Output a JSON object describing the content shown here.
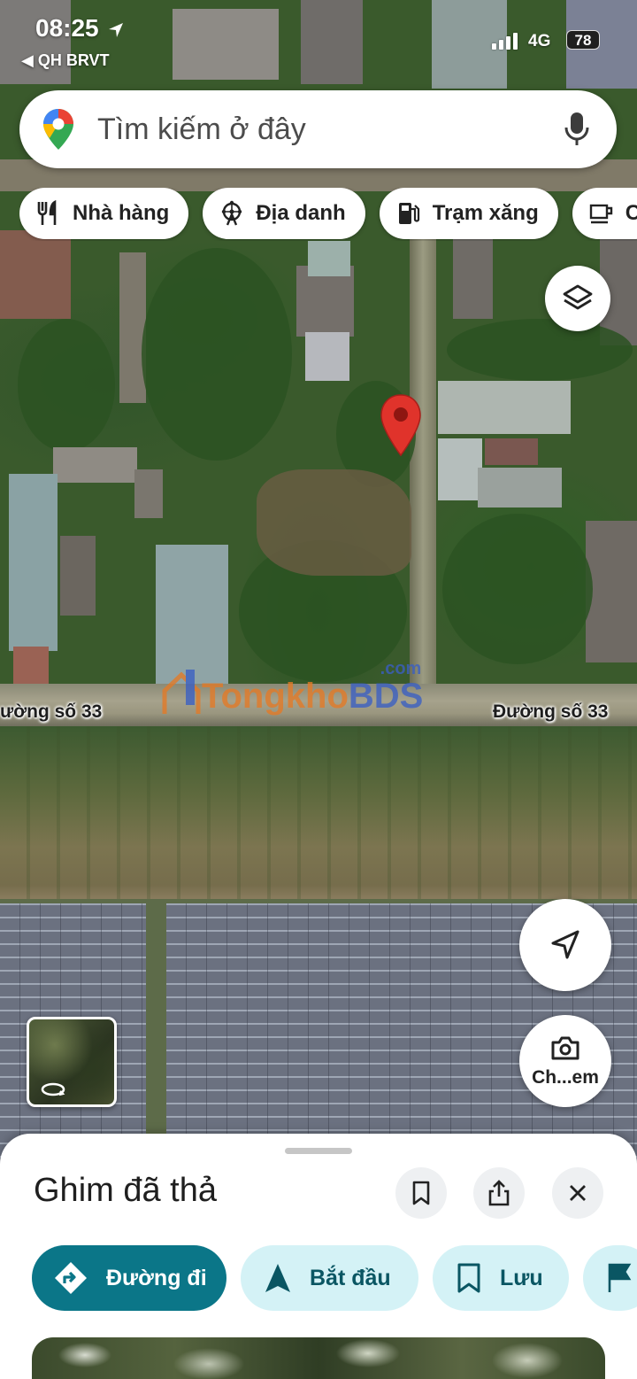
{
  "status_bar": {
    "time": "08:25",
    "back_app": "◀ QH BRVT",
    "network": "4G",
    "battery": "78"
  },
  "search": {
    "placeholder": "Tìm kiếm ở đây",
    "logo_icon": "maps-pin-logo-icon",
    "mic_icon": "microphone-icon"
  },
  "chips": [
    {
      "label": "Nhà hàng",
      "icon": "fork-knife-icon"
    },
    {
      "label": "Địa danh",
      "icon": "ferris-wheel-icon"
    },
    {
      "label": "Trạm xăng",
      "icon": "gas-pump-icon"
    },
    {
      "label": "C",
      "icon": "coffee-cup-icon"
    }
  ],
  "map": {
    "road_label_left": "ường số 33",
    "road_label_right": "Đường số 33",
    "watermark_part1": "Tongkho",
    "watermark_part2": "BDS",
    "watermark_suffix": ".com"
  },
  "map_controls": {
    "layers_icon": "layers-icon",
    "locate_icon": "navigation-arrow-icon",
    "camera_label": "Ch...em",
    "camera_icon": "camera-search-icon"
  },
  "sheet": {
    "title": "Ghim đã thả",
    "actions": [
      {
        "label": "Đường đi",
        "icon": "directions-icon"
      },
      {
        "label": "Bắt đầu",
        "icon": "navigation-start-icon"
      },
      {
        "label": "Lưu",
        "icon": "bookmark-icon"
      },
      {
        "label": "",
        "icon": "flag-icon"
      }
    ]
  },
  "colors": {
    "primary_teal": "#0b7688",
    "secondary_teal_bg": "#d4f2f6",
    "pin_red": "#e0332b"
  }
}
